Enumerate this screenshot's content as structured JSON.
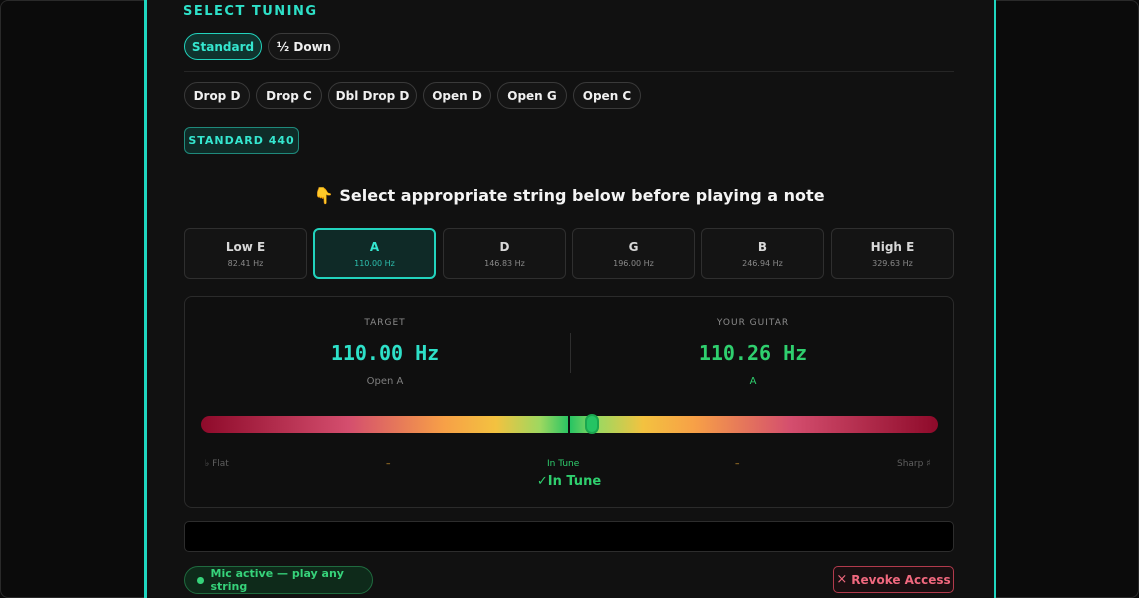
{
  "tuning": {
    "section_title": "SELECT TUNING",
    "row1": [
      "Standard",
      "½ Down"
    ],
    "row2": [
      "Drop D",
      "Drop C",
      "Dbl Drop D",
      "Open D",
      "Open G",
      "Open C"
    ],
    "selected": "Standard",
    "preset_badge": "STANDARD 440"
  },
  "instruction": {
    "emoji": "👇",
    "text": "Select appropriate string below before playing a note"
  },
  "strings": [
    {
      "name": "Low E",
      "hz": "82.41 Hz",
      "active": false
    },
    {
      "name": "A",
      "hz": "110.00 Hz",
      "active": true
    },
    {
      "name": "D",
      "hz": "146.83 Hz",
      "active": false
    },
    {
      "name": "G",
      "hz": "196.00 Hz",
      "active": false
    },
    {
      "name": "B",
      "hz": "246.94 Hz",
      "active": false
    },
    {
      "name": "High E",
      "hz": "329.63 Hz",
      "active": false
    }
  ],
  "meter": {
    "target_label": "TARGET",
    "target_value": "110.00 Hz",
    "target_note": "Open A",
    "guitar_label": "YOUR GUITAR",
    "guitar_value": "110.26 Hz",
    "guitar_note": "A",
    "needle_cents_fraction": 0.53,
    "scale_flat": "♭ Flat",
    "scale_dash_left": "–",
    "scale_center": "In Tune",
    "scale_dash_right": "–",
    "scale_sharp": "Sharp ♯",
    "status": "✓In Tune",
    "colors": {
      "target": "#2ee0c8",
      "guitar": "#2fcf6e"
    }
  },
  "footer": {
    "mic_status": "Mic active — play any string",
    "revoke_icon": "×",
    "revoke_label": "Revoke Access"
  }
}
